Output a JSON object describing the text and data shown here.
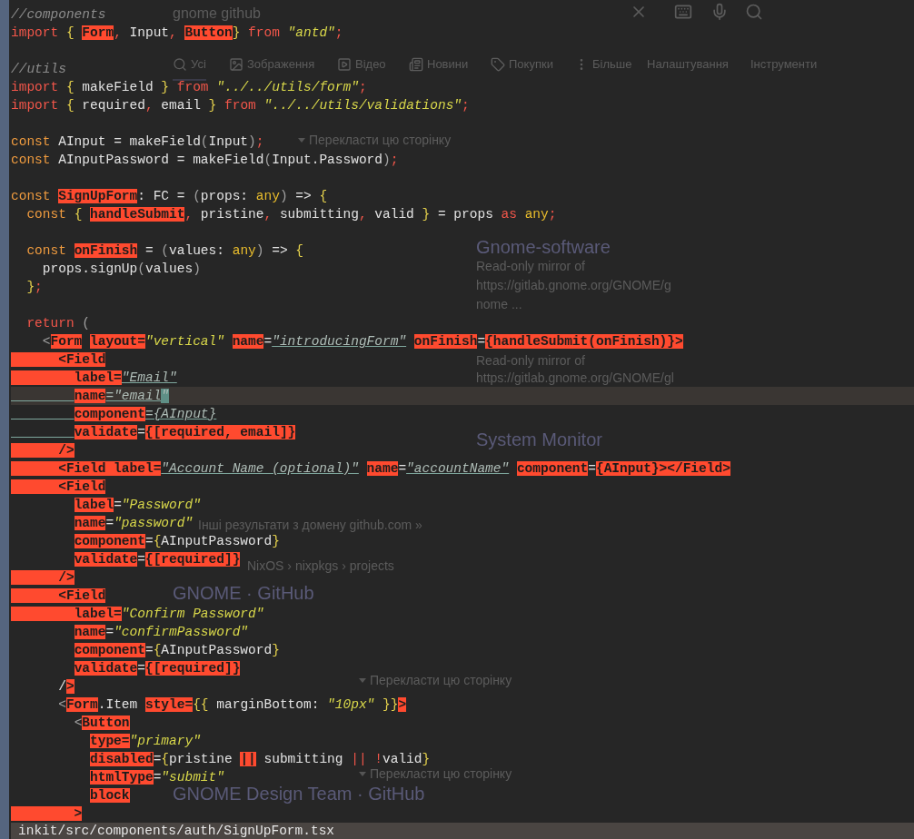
{
  "search_page": {
    "query": "gnome github",
    "tabs": [
      {
        "label": "Усі",
        "selected": true,
        "kind": "search"
      },
      {
        "label": "Зображення",
        "selected": false,
        "kind": "image"
      },
      {
        "label": "Відео",
        "selected": false,
        "kind": "video"
      },
      {
        "label": "Новини",
        "selected": false,
        "kind": "news"
      },
      {
        "label": "Покупки",
        "selected": false,
        "kind": "tag"
      },
      {
        "label": "Більше",
        "selected": false,
        "kind": "more"
      },
      {
        "label": "Налаштування",
        "selected": false,
        "kind": "none"
      },
      {
        "label": "Інструменти",
        "selected": false,
        "kind": "none"
      }
    ],
    "translate_links": [
      "Перекласти цю сторінку",
      "Перекласти цю сторінку",
      "Перекласти цю сторінку"
    ],
    "software_card": {
      "title": "Gnome-software",
      "lines": [
        "Read-only mirror of",
        "https://gitlab.gnome.org/GNOME/g",
        "nome ..."
      ]
    },
    "mirror_card": {
      "lines": [
        "Read-only mirror of",
        "https://gitlab.gnome.org/GNOME/gl"
      ]
    },
    "monitor_card": {
      "title": "System Monitor"
    },
    "more_results": "Інші результати з домену github.com »",
    "breadcrumb": "NixOS › nixpkgs › projects",
    "result_titles": [
      "GNOME · GitHub",
      "GNOME Design Team · GitHub"
    ]
  },
  "editor": {
    "lines": [
      {
        "kind": "code",
        "current": false,
        "underlined_indent": false,
        "tokens": [
          {
            "text": "//components",
            "kind": "comment"
          }
        ]
      },
      {
        "kind": "code",
        "current": false,
        "underlined_indent": false,
        "tokens": [
          {
            "text": "import",
            "kind": "keyword"
          },
          {
            "text": " {",
            "kind": "brace"
          },
          {
            "text": " Form",
            "kind": "mark"
          },
          {
            "text": ",",
            "kind": "punct"
          },
          {
            "text": " Input",
            "kind": "plain"
          },
          {
            "text": ",",
            "kind": "punct"
          },
          {
            "text": " Button",
            "kind": "mark"
          },
          {
            "text": "}",
            "kind": "brace"
          },
          {
            "text": " from",
            "kind": "keyword"
          },
          {
            "text": " \"antd\"",
            "kind": "string"
          },
          {
            "text": ";",
            "kind": "punct"
          }
        ]
      },
      {
        "kind": "blank"
      },
      {
        "kind": "code",
        "current": false,
        "underlined_indent": false,
        "tokens": [
          {
            "text": "//utils",
            "kind": "comment"
          }
        ]
      },
      {
        "kind": "code",
        "current": false,
        "underlined_indent": false,
        "tokens": [
          {
            "text": "import",
            "kind": "keyword"
          },
          {
            "text": " {",
            "kind": "brace"
          },
          {
            "text": " makeField",
            "kind": "plain"
          },
          {
            "text": " }",
            "kind": "brace"
          },
          {
            "text": " from",
            "kind": "keyword"
          },
          {
            "text": " \"../../utils/form\"",
            "kind": "string"
          },
          {
            "text": ";",
            "kind": "punct"
          }
        ]
      },
      {
        "kind": "code",
        "current": false,
        "underlined_indent": false,
        "tokens": [
          {
            "text": "import",
            "kind": "keyword"
          },
          {
            "text": " {",
            "kind": "brace"
          },
          {
            "text": " required",
            "kind": "plain"
          },
          {
            "text": ",",
            "kind": "punct"
          },
          {
            "text": " email",
            "kind": "plain"
          },
          {
            "text": " }",
            "kind": "brace"
          },
          {
            "text": " from",
            "kind": "keyword"
          },
          {
            "text": " \"../../utils/validations\"",
            "kind": "string"
          },
          {
            "text": ";",
            "kind": "punct"
          }
        ]
      },
      {
        "kind": "blank"
      },
      {
        "kind": "code",
        "current": false,
        "underlined_indent": false,
        "tokens": [
          {
            "text": "const",
            "kind": "decl"
          },
          {
            "text": " AInput = makeField",
            "kind": "plain"
          },
          {
            "text": "(",
            "kind": "dim"
          },
          {
            "text": "Input",
            "kind": "plain"
          },
          {
            "text": ")",
            "kind": "dim"
          },
          {
            "text": ";",
            "kind": "punct"
          }
        ]
      },
      {
        "kind": "code",
        "current": false,
        "underlined_indent": false,
        "tokens": [
          {
            "text": "const",
            "kind": "decl"
          },
          {
            "text": " AInputPassword = makeField",
            "kind": "plain"
          },
          {
            "text": "(",
            "kind": "dim"
          },
          {
            "text": "Input.Password",
            "kind": "plain"
          },
          {
            "text": ")",
            "kind": "dim"
          },
          {
            "text": ";",
            "kind": "punct"
          }
        ]
      },
      {
        "kind": "blank"
      },
      {
        "kind": "code",
        "current": false,
        "underlined_indent": false,
        "tokens": [
          {
            "text": "const",
            "kind": "decl"
          },
          {
            "text": " SignUpForm",
            "kind": "mark"
          },
          {
            "text": ": FC =",
            "kind": "plain"
          },
          {
            "text": " (",
            "kind": "dim"
          },
          {
            "text": "props:",
            "kind": "plain"
          },
          {
            "text": " any",
            "kind": "type"
          },
          {
            "text": ")",
            "kind": "dim"
          },
          {
            "text": " =>",
            "kind": "plain"
          },
          {
            "text": " {",
            "kind": "brace"
          }
        ]
      },
      {
        "kind": "code",
        "current": false,
        "underlined_indent": false,
        "tokens": [
          {
            "text": "  const",
            "kind": "decl"
          },
          {
            "text": " {",
            "kind": "brace"
          },
          {
            "text": " handleSubmit",
            "kind": "mark"
          },
          {
            "text": ",",
            "kind": "punct"
          },
          {
            "text": " pristine",
            "kind": "plain"
          },
          {
            "text": ",",
            "kind": "punct"
          },
          {
            "text": " submitting",
            "kind": "plain"
          },
          {
            "text": ",",
            "kind": "punct"
          },
          {
            "text": " valid",
            "kind": "plain"
          },
          {
            "text": " }",
            "kind": "brace"
          },
          {
            "text": " = props",
            "kind": "plain"
          },
          {
            "text": " as",
            "kind": "keyword"
          },
          {
            "text": " any",
            "kind": "type"
          },
          {
            "text": ";",
            "kind": "punct"
          }
        ]
      },
      {
        "kind": "blank"
      },
      {
        "kind": "code",
        "current": false,
        "underlined_indent": false,
        "tokens": [
          {
            "text": "  const",
            "kind": "decl"
          },
          {
            "text": " onFinish",
            "kind": "mark"
          },
          {
            "text": " =",
            "kind": "plain"
          },
          {
            "text": " (",
            "kind": "dim"
          },
          {
            "text": "values:",
            "kind": "plain"
          },
          {
            "text": " any",
            "kind": "type"
          },
          {
            "text": ")",
            "kind": "dim"
          },
          {
            "text": " =>",
            "kind": "plain"
          },
          {
            "text": " {",
            "kind": "brace"
          }
        ]
      },
      {
        "kind": "code",
        "current": false,
        "underlined_indent": false,
        "tokens": [
          {
            "text": "    props.signUp",
            "kind": "plain"
          },
          {
            "text": "(",
            "kind": "dim"
          },
          {
            "text": "values",
            "kind": "plain"
          },
          {
            "text": ")",
            "kind": "dim"
          }
        ]
      },
      {
        "kind": "code",
        "current": false,
        "underlined_indent": false,
        "tokens": [
          {
            "text": "  }",
            "kind": "brace"
          },
          {
            "text": ";",
            "kind": "punct"
          }
        ]
      },
      {
        "kind": "blank"
      },
      {
        "kind": "code",
        "current": false,
        "underlined_indent": false,
        "tokens": [
          {
            "text": "  return",
            "kind": "keyword"
          },
          {
            "text": " (",
            "kind": "dim"
          }
        ]
      },
      {
        "kind": "code",
        "current": false,
        "underlined_indent": false,
        "tokens": [
          {
            "text": "    <",
            "kind": "dim"
          },
          {
            "text": "Form",
            "kind": "mark"
          },
          {
            "text": " layout=",
            "kind": "mark"
          },
          {
            "text": "\"vertical\"",
            "kind": "string"
          },
          {
            "text": " name",
            "kind": "mark"
          },
          {
            "text": "=",
            "kind": "plain"
          },
          {
            "text": "\"introducingForm\"",
            "kind": "linked"
          },
          {
            "text": " onFinish",
            "kind": "mark"
          },
          {
            "text": "=",
            "kind": "plain"
          },
          {
            "text": "{handleSubmit(onFinish)}>",
            "kind": "mark"
          }
        ]
      },
      {
        "kind": "code",
        "current": false,
        "underlined_indent": false,
        "tokens": [
          {
            "text": "      <Field",
            "kind": "block_mark"
          }
        ]
      },
      {
        "kind": "code",
        "current": false,
        "underlined_indent": false,
        "tokens": [
          {
            "text": "        label=",
            "kind": "block_mark"
          },
          {
            "text": "\"Email\"",
            "kind": "linked"
          }
        ]
      },
      {
        "kind": "code",
        "current": true,
        "underlined_indent": true,
        "tokens": [
          {
            "text": "        name",
            "kind": "mark"
          },
          {
            "text": "=\"email",
            "kind": "linked"
          },
          {
            "text": "\"",
            "kind": "cursor"
          }
        ]
      },
      {
        "kind": "code",
        "current": false,
        "underlined_indent": true,
        "tokens": [
          {
            "text": "        component",
            "kind": "mark"
          },
          {
            "text": "={AInput}",
            "kind": "linked"
          }
        ]
      },
      {
        "kind": "code",
        "current": false,
        "underlined_indent": true,
        "tokens": [
          {
            "text": "        validate",
            "kind": "mark"
          },
          {
            "text": "=",
            "kind": "plain"
          },
          {
            "text": "{[required, email]}",
            "kind": "mark"
          }
        ]
      },
      {
        "kind": "code",
        "current": false,
        "underlined_indent": false,
        "tokens": [
          {
            "text": "      />",
            "kind": "block_mark"
          }
        ]
      },
      {
        "kind": "code",
        "current": false,
        "underlined_indent": false,
        "tokens": [
          {
            "text": "      <Field label=",
            "kind": "block_mark"
          },
          {
            "text": "\"Account Name (optional)\"",
            "kind": "linked"
          },
          {
            "text": " name",
            "kind": "mark"
          },
          {
            "text": "=",
            "kind": "plain"
          },
          {
            "text": "\"accountName\"",
            "kind": "linked"
          },
          {
            "text": " component",
            "kind": "mark"
          },
          {
            "text": "=",
            "kind": "plain"
          },
          {
            "text": "{AInput}></Field>",
            "kind": "mark"
          }
        ]
      },
      {
        "kind": "code",
        "current": false,
        "underlined_indent": false,
        "tokens": [
          {
            "text": "      <Field",
            "kind": "block_mark"
          }
        ]
      },
      {
        "kind": "code",
        "current": false,
        "underlined_indent": false,
        "tokens": [
          {
            "text": "        label",
            "kind": "mark"
          },
          {
            "text": "=",
            "kind": "plain"
          },
          {
            "text": "\"Password\"",
            "kind": "string"
          }
        ]
      },
      {
        "kind": "code",
        "current": false,
        "underlined_indent": false,
        "tokens": [
          {
            "text": "        name",
            "kind": "mark"
          },
          {
            "text": "=",
            "kind": "plain"
          },
          {
            "text": "\"password\"",
            "kind": "string"
          }
        ]
      },
      {
        "kind": "code",
        "current": false,
        "underlined_indent": false,
        "tokens": [
          {
            "text": "        component",
            "kind": "mark"
          },
          {
            "text": "=",
            "kind": "plain"
          },
          {
            "text": "{",
            "kind": "brace"
          },
          {
            "text": "AInputPassword",
            "kind": "plain"
          },
          {
            "text": "}",
            "kind": "brace"
          }
        ]
      },
      {
        "kind": "code",
        "current": false,
        "underlined_indent": false,
        "tokens": [
          {
            "text": "        validate",
            "kind": "mark"
          },
          {
            "text": "=",
            "kind": "plain"
          },
          {
            "text": "{[required]}",
            "kind": "mark"
          }
        ]
      },
      {
        "kind": "code",
        "current": false,
        "underlined_indent": false,
        "tokens": [
          {
            "text": "      />",
            "kind": "block_mark"
          }
        ]
      },
      {
        "kind": "code",
        "current": false,
        "underlined_indent": false,
        "tokens": [
          {
            "text": "      <Field",
            "kind": "block_mark"
          }
        ]
      },
      {
        "kind": "code",
        "current": false,
        "underlined_indent": false,
        "tokens": [
          {
            "text": "        label=",
            "kind": "block_mark"
          },
          {
            "text": "\"Confirm Password\"",
            "kind": "string"
          }
        ]
      },
      {
        "kind": "code",
        "current": false,
        "underlined_indent": false,
        "tokens": [
          {
            "text": "        name",
            "kind": "mark"
          },
          {
            "text": "=",
            "kind": "plain"
          },
          {
            "text": "\"confirmPassword\"",
            "kind": "string"
          }
        ]
      },
      {
        "kind": "code",
        "current": false,
        "underlined_indent": false,
        "tokens": [
          {
            "text": "        component",
            "kind": "mark"
          },
          {
            "text": "=",
            "kind": "plain"
          },
          {
            "text": "{",
            "kind": "brace"
          },
          {
            "text": "AInputPassword",
            "kind": "plain"
          },
          {
            "text": "}",
            "kind": "brace"
          }
        ]
      },
      {
        "kind": "code",
        "current": false,
        "underlined_indent": false,
        "tokens": [
          {
            "text": "        validate",
            "kind": "mark"
          },
          {
            "text": "=",
            "kind": "plain"
          },
          {
            "text": "{[required]}",
            "kind": "mark"
          }
        ]
      },
      {
        "kind": "code",
        "current": false,
        "underlined_indent": false,
        "tokens": [
          {
            "text": "      /",
            "kind": "plain"
          },
          {
            "text": ">",
            "kind": "mark"
          }
        ]
      },
      {
        "kind": "code",
        "current": false,
        "underlined_indent": false,
        "tokens": [
          {
            "text": "      <",
            "kind": "dim"
          },
          {
            "text": "Form",
            "kind": "mark"
          },
          {
            "text": ".Item",
            "kind": "plain"
          },
          {
            "text": " style=",
            "kind": "mark"
          },
          {
            "text": "{{",
            "kind": "brace"
          },
          {
            "text": " marginBottom:",
            "kind": "plain"
          },
          {
            "text": " \"10px\"",
            "kind": "string"
          },
          {
            "text": " }}",
            "kind": "brace"
          },
          {
            "text": ">",
            "kind": "mark"
          }
        ]
      },
      {
        "kind": "code",
        "current": false,
        "underlined_indent": false,
        "tokens": [
          {
            "text": "        <",
            "kind": "dim"
          },
          {
            "text": "Button",
            "kind": "mark"
          }
        ]
      },
      {
        "kind": "code",
        "current": false,
        "underlined_indent": false,
        "tokens": [
          {
            "text": "          type=",
            "kind": "mark"
          },
          {
            "text": "\"primary\"",
            "kind": "string"
          }
        ]
      },
      {
        "kind": "code",
        "current": false,
        "underlined_indent": false,
        "tokens": [
          {
            "text": "          disabled",
            "kind": "mark"
          },
          {
            "text": "=",
            "kind": "plain"
          },
          {
            "text": "{",
            "kind": "brace"
          },
          {
            "text": "pristine",
            "kind": "plain"
          },
          {
            "text": " ||",
            "kind": "mark"
          },
          {
            "text": " submitting",
            "kind": "plain"
          },
          {
            "text": " ||",
            "kind": "punct"
          },
          {
            "text": " !",
            "kind": "punct"
          },
          {
            "text": "valid",
            "kind": "plain"
          },
          {
            "text": "}",
            "kind": "brace"
          }
        ]
      },
      {
        "kind": "code",
        "current": false,
        "underlined_indent": false,
        "tokens": [
          {
            "text": "          htmlType",
            "kind": "mark"
          },
          {
            "text": "=",
            "kind": "plain"
          },
          {
            "text": "\"submit\"",
            "kind": "string"
          }
        ]
      },
      {
        "kind": "code",
        "current": false,
        "underlined_indent": false,
        "tokens": [
          {
            "text": "          block",
            "kind": "mark"
          }
        ]
      },
      {
        "kind": "code",
        "current": false,
        "underlined_indent": false,
        "tokens": [
          {
            "text": "        >",
            "kind": "block_mark"
          }
        ]
      }
    ],
    "status_bar": "inkit/src/components/auth/SignUpForm.tsx"
  }
}
